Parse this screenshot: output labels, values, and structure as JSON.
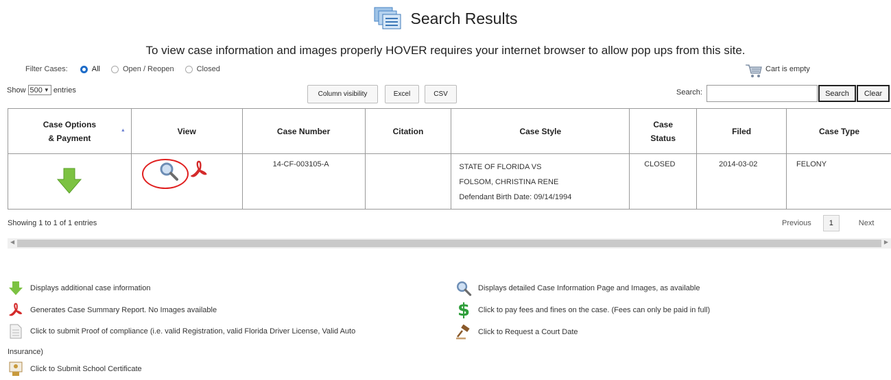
{
  "header": {
    "title": "Search Results",
    "notice": "To view case information and images properly HOVER requires your internet browser to allow pop ups from this site."
  },
  "filter": {
    "label": "Filter Cases:",
    "options": [
      "All",
      "Open / Reopen",
      "Closed"
    ],
    "selected": "All"
  },
  "cart": {
    "label": "Cart is empty",
    "icon": "cart-icon"
  },
  "length": {
    "prefix": "Show",
    "value": "500",
    "suffix": "entries"
  },
  "toolbar": {
    "column_visibility": "Column visibility",
    "excel": "Excel",
    "csv": "CSV"
  },
  "search": {
    "label": "Search:",
    "value": "",
    "search_button": "Search",
    "clear_button": "Clear"
  },
  "table": {
    "headers": {
      "options_line1": "Case Options",
      "options_line2": "& Payment",
      "view": "View",
      "case_number": "Case Number",
      "citation": "Citation",
      "case_style": "Case Style",
      "status_line1": "Case",
      "status_line2": "Status",
      "filed": "Filed",
      "case_type": "Case Type"
    },
    "rows": [
      {
        "case_number": "14-CF-003105-A",
        "citation": "",
        "style_line1": "STATE OF FLORIDA VS",
        "style_line2": "FOLSOM, CHRISTINA RENE",
        "style_line3": "Defendant Birth Date: 09/14/1994",
        "status": "CLOSED",
        "filed": "2014-03-02",
        "case_type": "FELONY"
      }
    ]
  },
  "info": "Showing 1 to 1 of 1 entries",
  "pager": {
    "previous": "Previous",
    "page": "1",
    "next": "Next"
  },
  "legend": {
    "additional": "Displays additional case information",
    "summary": "Generates Case Summary Report. No Images available",
    "compliance_line1": "Click to submit Proof of compliance (i.e. valid Registration, valid Florida Driver License, Valid Auto",
    "compliance_line2": "Insurance)",
    "school": "Click to Submit School Certificate",
    "detailed": "Displays detailed Case Information Page and Images, as available",
    "pay": "Click to pay fees and fines on the case. (Fees can only be paid in full)",
    "court_date": "Click to Request a Court Date"
  },
  "colors": {
    "accent_green": "#7cc242",
    "pdf_red": "#d42a2a",
    "highlight_circle": "#e02020",
    "radio_blue": "#1e6cc8",
    "dollar_green": "#2e9e3a"
  }
}
